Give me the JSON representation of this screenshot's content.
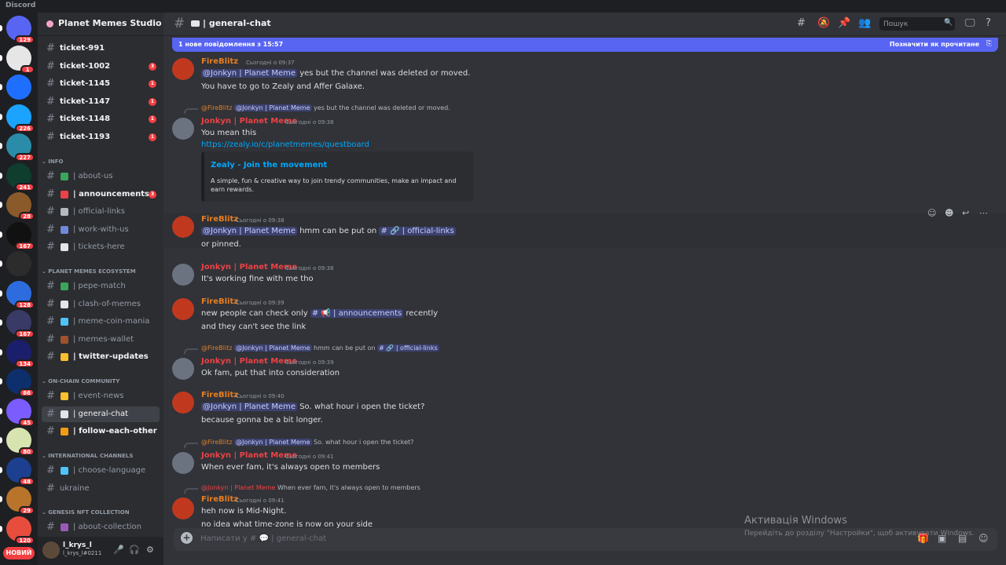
{
  "app": {
    "title": "Discord"
  },
  "servers": [
    {
      "badge": "129",
      "color": "#5865f2"
    },
    {
      "badge": "1",
      "color": "#e6e6e6"
    },
    {
      "badge": "",
      "color": "#1e6fff"
    },
    {
      "badge": "226",
      "color": "#1aa3ff"
    },
    {
      "badge": "227",
      "color": "#2a8ca8"
    },
    {
      "badge": "241",
      "color": "#0f3d2e"
    },
    {
      "badge": "28",
      "color": "#8a5a2b"
    },
    {
      "badge": "167",
      "color": "#111111"
    },
    {
      "badge": "",
      "color": "#2c2c2c"
    },
    {
      "badge": "128",
      "color": "#2d6cdf"
    },
    {
      "badge": "167",
      "color": "#3a3a66"
    },
    {
      "badge": "134",
      "color": "#1b1f6b"
    },
    {
      "badge": "66",
      "color": "#0d2f6b"
    },
    {
      "badge": "45",
      "color": "#7b5cff"
    },
    {
      "badge": "80",
      "color": "#d8e4b0"
    },
    {
      "badge": "48",
      "color": "#1c3f8f"
    },
    {
      "badge": "29",
      "color": "#b8742a"
    },
    {
      "badge": "120",
      "color": "#e74c3c"
    }
  ],
  "new_label": "НОВИЙ",
  "guild": {
    "name": "Planet Memes Studio",
    "icon_color": "#f0a5c8"
  },
  "channels": {
    "tickets": [
      {
        "name": "ticket-991",
        "badge": "",
        "unread": true
      },
      {
        "name": "ticket-1002",
        "badge": "3",
        "unread": true
      },
      {
        "name": "ticket-1145",
        "badge": "1",
        "unread": true
      },
      {
        "name": "ticket-1147",
        "badge": "1",
        "unread": true
      },
      {
        "name": "ticket-1148",
        "badge": "1",
        "unread": true
      },
      {
        "name": "ticket-1193",
        "badge": "1",
        "unread": true
      }
    ],
    "info_label": "INFO",
    "info": [
      {
        "name": "about-us",
        "emoji_color": "#3ba55c",
        "badge": "",
        "unread": false
      },
      {
        "name": "announcements",
        "emoji_color": "#ed4245",
        "badge": "3",
        "unread": true
      },
      {
        "name": "official-links",
        "emoji_color": "#b5bac1",
        "badge": "",
        "unread": false
      },
      {
        "name": "work-with-us",
        "emoji_color": "#7289da",
        "badge": "",
        "unread": false
      },
      {
        "name": "tickets-here",
        "emoji_color": "#e3e5e8",
        "badge": "",
        "unread": false
      }
    ],
    "eco_label": "PLANET MEMES ECOSYSTEM",
    "eco": [
      {
        "name": "pepe-match",
        "emoji_color": "#3ba55c",
        "unread": false
      },
      {
        "name": "clash-of-memes",
        "emoji_color": "#e3e5e8",
        "unread": false
      },
      {
        "name": "meme-coin-mania",
        "emoji_color": "#4fc3f7",
        "unread": false
      },
      {
        "name": "memes-wallet",
        "emoji_color": "#a0522d",
        "unread": false
      },
      {
        "name": "twitter-updates",
        "emoji_color": "#fbc02d",
        "unread": true
      }
    ],
    "onchain_label": "ON-CHAIN COMMUNITY",
    "onchain": [
      {
        "name": "event-news",
        "emoji_color": "#fbc02d",
        "unread": false
      },
      {
        "name": "general-chat",
        "emoji_color": "#e3e5e8",
        "unread": false,
        "active": true
      },
      {
        "name": "follow-each-other",
        "emoji_color": "#f39c12",
        "unread": true
      }
    ],
    "intl_label": "INTERNATIONAL CHANNELS",
    "intl": [
      {
        "name": "choose-language",
        "emoji_color": "#4fc3f7"
      },
      {
        "name": "ukraine",
        "emoji_color": ""
      }
    ],
    "nft_label": "GENESIS NFT COLLECTION",
    "nft": [
      {
        "name": "about-collection",
        "emoji_color": "#9b59b6"
      }
    ]
  },
  "user": {
    "name": "l_krys_l",
    "tag": "l_krys_l#0211"
  },
  "header": {
    "channel": "| general-chat",
    "search_placeholder": "Пошук"
  },
  "newbar": {
    "left": "1 нове повідомлення з 15:57",
    "right": "Позначити як прочитане"
  },
  "messages": {
    "m1": {
      "author": "FireBlitz",
      "time": "Сьогодні о 09:37",
      "mention": "@Jonkyn | Planet Meme",
      "line1": " yes but the channel was deleted or moved.",
      "line2": "You have to go to Zealy and Affer Galaxe."
    },
    "m2": {
      "reply_author": "@FireBlitz",
      "reply_mention": "@Jonkyn | Planet Meme",
      "reply_text": " yes but the channel was deleted or moved.",
      "author": "Jonkyn | Planet Meme",
      "time": "Сьогодні о 09:38",
      "line1": "You mean this",
      "link": "https://zealy.io/c/planetmemes/questboard",
      "embed_title": "Zealy - Join the movement",
      "embed_desc": "A simple, fun & creative way to join trendy communities, make an impact and earn rewards."
    },
    "m3": {
      "author": "FireBlitz",
      "time": "Сьогодні о 09:38",
      "mention": "@Jonkyn | Planet Meme",
      "text": " hmm can be put on ",
      "chan": "# 🔗 | official-links",
      "line2": "or pinned."
    },
    "m4": {
      "author": "Jonkyn | Planet Meme",
      "time": "Сьогодні о 09:38",
      "line1": "It's working fine with me tho"
    },
    "m5": {
      "author": "FireBlitz",
      "time": "Сьогодні о 09:39",
      "text": "new people can check only ",
      "chan": "# 📢 | announcements",
      "after": " recently",
      "line2": "and they can't see the link"
    },
    "m6": {
      "reply_author": "@FireBlitz",
      "reply_mention": "@Jonkyn | Planet Meme",
      "reply_text": " hmm can be put on ",
      "reply_chan": "# 🔗 | official-links",
      "author": "Jonkyn | Planet Meme",
      "time": "Сьогодні о 09:39",
      "line1": "Ok fam, put that into consideration"
    },
    "m7": {
      "author": "FireBlitz",
      "time": "Сьогодні о 09:40",
      "mention": "@Jonkyn | Planet Meme",
      "text": " So. what hour i open the ticket?",
      "line2": "because gonna be a bit longer."
    },
    "m8": {
      "reply_author": "@FireBlitz",
      "reply_mention": "@Jonkyn | Planet Meme",
      "reply_text": " So. what hour i open the ticket?",
      "author": "Jonkyn | Planet Meme",
      "time": "Сьогодні о 09:41",
      "line1": "When ever fam, it's always open to members"
    },
    "m9": {
      "reply_author": "@Jonkyn | Planet Meme",
      "reply_text": " When ever fam, it's always open to members",
      "author": "FireBlitz",
      "time": "Сьогодні о 09:41",
      "line1": "heh now is Mid-Night.",
      "line2": "no idea what time-zone is now on your side"
    }
  },
  "composer": {
    "placeholder": "Написати у # 💬 | general-chat"
  },
  "watermark": {
    "title": "Активація Windows",
    "sub": "Перейдіть до розділу \"Настройки\", щоб активувати Windows."
  }
}
